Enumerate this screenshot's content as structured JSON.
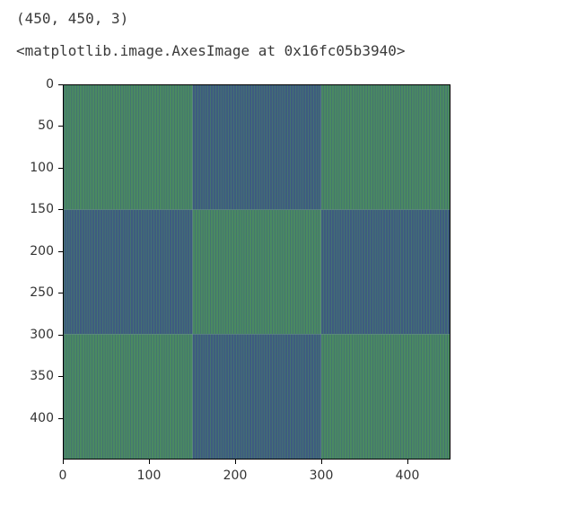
{
  "output": {
    "shape_text": "(450, 450, 3)",
    "repr_text": "<matplotlib.image.AxesImage at 0x16fc05b3940>"
  },
  "chart_data": {
    "type": "heatmap",
    "title": "",
    "xlabel": "",
    "ylabel": "",
    "xlim": [
      0,
      450
    ],
    "ylim": [
      0,
      450
    ],
    "xticks": [
      0,
      100,
      200,
      300,
      400
    ],
    "yticks": [
      0,
      50,
      100,
      150,
      200,
      250,
      300,
      350,
      400
    ],
    "image_shape": [
      450,
      450,
      3
    ],
    "block_boundaries": [
      0,
      150,
      300,
      450
    ],
    "colors": {
      "green": "#4a8a61",
      "blue": "#3e5b80"
    },
    "blocks": [
      {
        "row": 0,
        "col": 0,
        "color": "green"
      },
      {
        "row": 0,
        "col": 1,
        "color": "blue"
      },
      {
        "row": 0,
        "col": 2,
        "color": "green"
      },
      {
        "row": 1,
        "col": 0,
        "color": "blue"
      },
      {
        "row": 1,
        "col": 1,
        "color": "green"
      },
      {
        "row": 1,
        "col": 2,
        "color": "blue"
      },
      {
        "row": 2,
        "col": 0,
        "color": "green"
      },
      {
        "row": 2,
        "col": 1,
        "color": "blue"
      },
      {
        "row": 2,
        "col": 2,
        "color": "green"
      }
    ],
    "hatch_spacing": 3
  }
}
